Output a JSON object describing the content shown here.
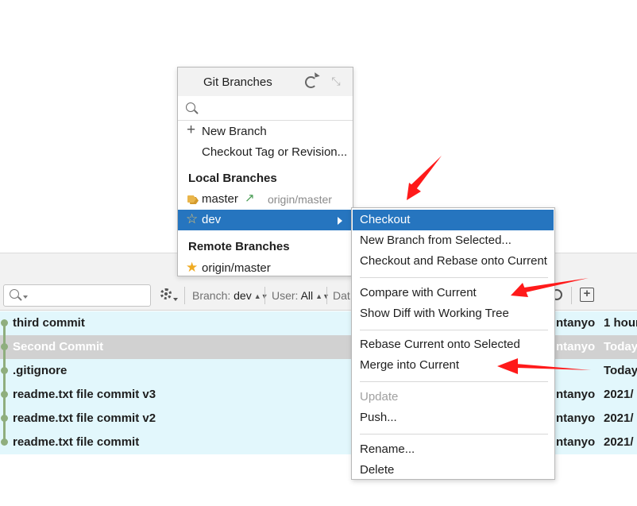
{
  "git_branches_popup": {
    "title": "Git Branches",
    "search_placeholder": "",
    "actions": [
      {
        "label": "New Branch",
        "icon": "plus-icon"
      },
      {
        "label": "Checkout Tag or Revision..."
      }
    ],
    "local_section_title": "Local Branches",
    "local_branches": [
      {
        "name": "master",
        "icon": "tag-icon",
        "tracking_icon": "outgoing-arrow-icon",
        "remote": "origin/master"
      },
      {
        "name": "dev",
        "icon": "star-outline-icon",
        "selected": true
      }
    ],
    "remote_section_title": "Remote Branches",
    "remote_branches": [
      {
        "name": "origin/master",
        "icon": "star-filled-icon"
      }
    ]
  },
  "branch_context_menu": {
    "items": [
      {
        "label": "Checkout",
        "highlighted": true
      },
      {
        "label": "New Branch from Selected..."
      },
      {
        "label": "Checkout and Rebase onto Current"
      },
      {
        "label": "Compare with Current"
      },
      {
        "label": "Show Diff with Working Tree"
      },
      {
        "label": "Rebase Current onto Selected"
      },
      {
        "label": "Merge into Current"
      },
      {
        "label": "Update",
        "disabled": true
      },
      {
        "label": "Push..."
      },
      {
        "label": "Rename..."
      },
      {
        "label": "Delete"
      }
    ]
  },
  "log_toolbar": {
    "branch_filter_label": "Branch:",
    "branch_filter_value": "dev",
    "user_filter_label": "User:",
    "user_filter_value": "All",
    "date_filter_label": "Dat"
  },
  "commits": [
    {
      "message": "third commit",
      "author": "ntanyo",
      "date": "1 hour"
    },
    {
      "message": "Second Commit",
      "author": "ntanyo",
      "date": "Today",
      "selected": true
    },
    {
      "message": ".gitignore",
      "author": "",
      "date": "Today"
    },
    {
      "message": "readme.txt file commit v3",
      "author": "ntanyo",
      "date": "2021/"
    },
    {
      "message": "readme.txt file commit v2",
      "author": "ntanyo",
      "date": "2021/"
    },
    {
      "message": "readme.txt file commit",
      "author": "ntanyo",
      "date": "2021/"
    }
  ],
  "colors": {
    "selection_blue": "#2675bf",
    "commit_row_bg": "#e2f7fc",
    "selected_commit_bg": "#d1d1d1",
    "graph_green": "#8fae7e",
    "annotation_red": "#ff1a1a"
  }
}
